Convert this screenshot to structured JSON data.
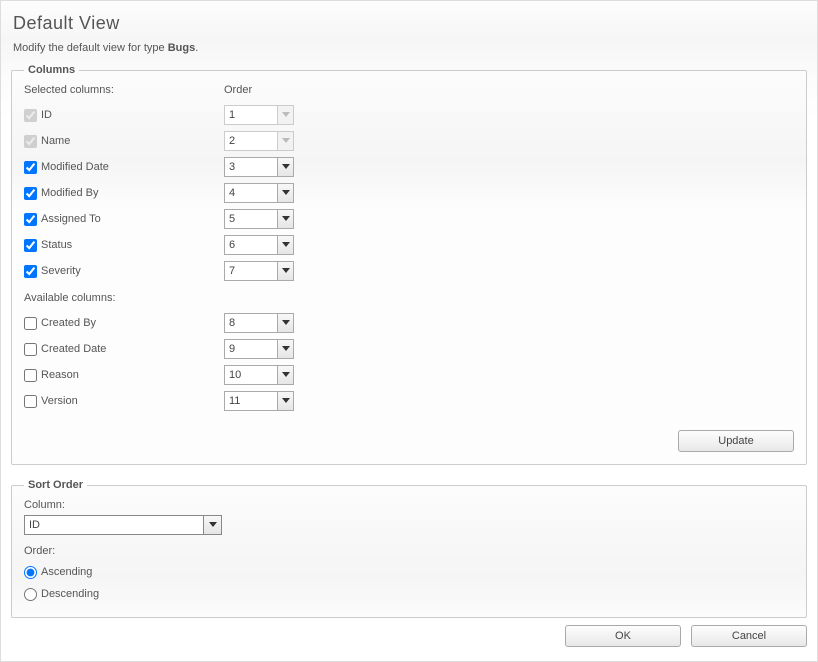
{
  "title": "Default View",
  "description_prefix": "Modify the default view for type ",
  "description_type": "Bugs",
  "description_suffix": ".",
  "columns_legend": "Columns",
  "selected_columns_label": "Selected columns:",
  "order_header": "Order",
  "available_columns_label": "Available columns:",
  "selected_columns": [
    {
      "label": "ID",
      "checked": true,
      "disabled": true,
      "order": "1"
    },
    {
      "label": "Name",
      "checked": true,
      "disabled": true,
      "order": "2"
    },
    {
      "label": "Modified Date",
      "checked": true,
      "disabled": false,
      "order": "3"
    },
    {
      "label": "Modified By",
      "checked": true,
      "disabled": false,
      "order": "4"
    },
    {
      "label": "Assigned To",
      "checked": true,
      "disabled": false,
      "order": "5"
    },
    {
      "label": "Status",
      "checked": true,
      "disabled": false,
      "order": "6"
    },
    {
      "label": "Severity",
      "checked": true,
      "disabled": false,
      "order": "7"
    }
  ],
  "available_columns": [
    {
      "label": "Created By",
      "checked": false,
      "order": "8"
    },
    {
      "label": "Created Date",
      "checked": false,
      "order": "9"
    },
    {
      "label": "Reason",
      "checked": false,
      "order": "10"
    },
    {
      "label": "Version",
      "checked": false,
      "order": "11"
    }
  ],
  "update_button": "Update",
  "sort_order_legend": "Sort Order",
  "column_label": "Column:",
  "column_value": "ID",
  "order_label": "Order:",
  "ascending_label": "Ascending",
  "descending_label": "Descending",
  "sort_direction": "ascending",
  "ok_button": "OK",
  "cancel_button": "Cancel"
}
